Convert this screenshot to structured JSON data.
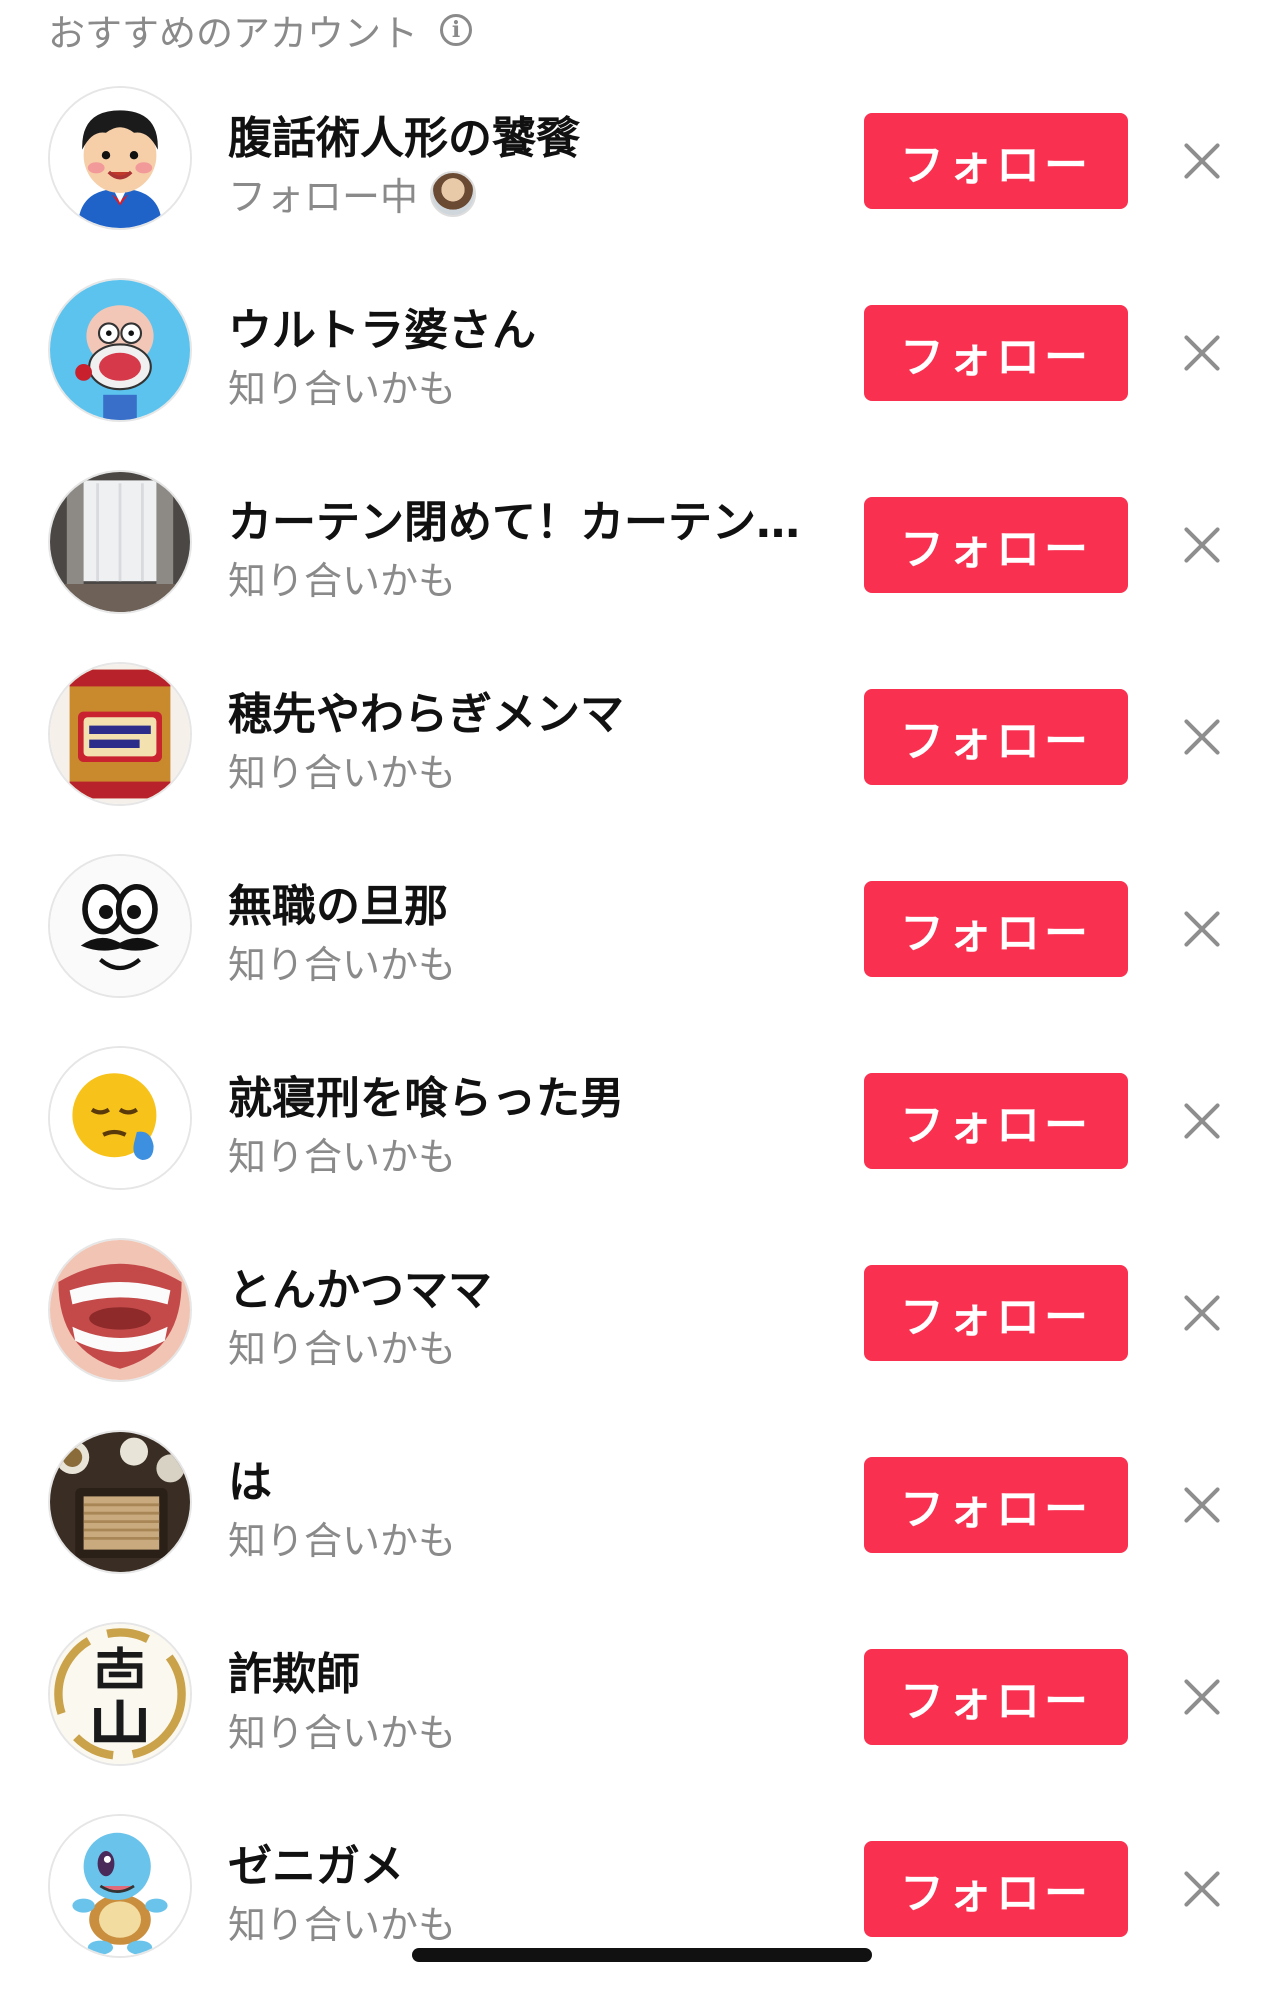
{
  "header": {
    "title": "おすすめのアカウント",
    "info_icon": "info-icon"
  },
  "follow_color": "#f9304f",
  "accounts": [
    {
      "name": "腹話術人形の饕餮",
      "sub": "フォロー中",
      "button": "フォロー",
      "avatar": "cartoon-boy"
    },
    {
      "name": "ウルトラ婆さん",
      "sub": "知り合いかも",
      "button": "フォロー",
      "avatar": "cartoon-grandma"
    },
    {
      "name": "カーテン閉めて！カーテン…",
      "sub": "知り合いかも",
      "button": "フォロー",
      "avatar": "curtain-photo"
    },
    {
      "name": "穂先やわらぎメンマ",
      "sub": "知り合いかも",
      "button": "フォロー",
      "avatar": "menma-jar"
    },
    {
      "name": "無職の旦那",
      "sub": "知り合いかも",
      "button": "フォロー",
      "avatar": "mustache-face"
    },
    {
      "name": "就寝刑を喰らった男",
      "sub": "知り合いかも",
      "button": "フォロー",
      "avatar": "sleepy-emoji"
    },
    {
      "name": "とんかつママ",
      "sub": "知り合いかも",
      "button": "フォロー",
      "avatar": "teeth-photo"
    },
    {
      "name": "は",
      "sub": "知り合いかも",
      "button": "フォロー",
      "avatar": "soba-photo"
    },
    {
      "name": "詐欺師",
      "sub": "知り合いかも",
      "button": "フォロー",
      "avatar": "calligraphy"
    },
    {
      "name": "ゼニガメ",
      "sub": "知り合いかも",
      "button": "フォロー",
      "avatar": "squirtle"
    }
  ]
}
